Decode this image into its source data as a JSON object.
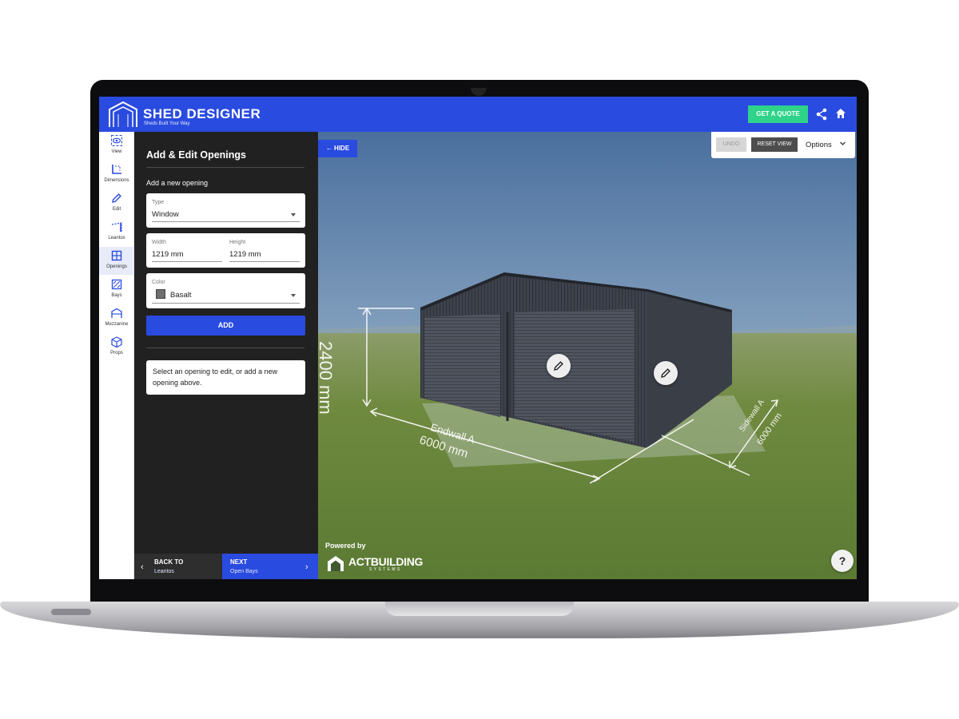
{
  "header": {
    "brand_title": "SHED DESIGNER",
    "brand_subtitle": "Sheds Built Your Way",
    "quote_label": "GET A QUOTE",
    "share_icon": "share-icon",
    "home_icon": "home-icon",
    "accent_color": "#2a4bdf",
    "quote_color": "#2fd38a"
  },
  "rail": {
    "items": [
      {
        "label": "View",
        "icon": "eye-icon"
      },
      {
        "label": "Dimensions",
        "icon": "dimensions-icon"
      },
      {
        "label": "Edit",
        "icon": "pencil-icon"
      },
      {
        "label": "Leantos",
        "icon": "leanto-icon"
      },
      {
        "label": "Openings",
        "icon": "openings-icon",
        "active": true
      },
      {
        "label": "Bays",
        "icon": "bays-icon"
      },
      {
        "label": "Mezzanine",
        "icon": "mezzanine-icon"
      },
      {
        "label": "Props",
        "icon": "cube-icon"
      }
    ]
  },
  "panel": {
    "title": "Add & Edit Openings",
    "subtitle": "Add a new opening",
    "type": {
      "label": "Type",
      "value": "Window"
    },
    "width": {
      "label": "Width",
      "value": "1219 mm"
    },
    "height": {
      "label": "Height",
      "value": "1219 mm"
    },
    "color": {
      "label": "Color",
      "value": "Basalt",
      "swatch": "#6e6e6e"
    },
    "add_label": "ADD",
    "hint": "Select an opening to edit, or add a new opening above.",
    "back": {
      "title": "BACK TO",
      "subtitle": "Leantos"
    },
    "next": {
      "title": "NEXT",
      "subtitle": "Open Bays"
    }
  },
  "viewport": {
    "hide_label": "← HIDE",
    "undo_label": "UNDO",
    "reset_label": "RESET VIEW",
    "options_label": "Options",
    "powered_by": "Powered by",
    "act_name": "ACTBUILDING",
    "act_sub": "SYSTEMS",
    "help_label": "?",
    "dimensions": {
      "height": "2400 mm",
      "front_wall": "Endwall A",
      "front_length": "6000 mm",
      "side_wall": "Sidewall A",
      "side_length": "6000 mm"
    }
  }
}
